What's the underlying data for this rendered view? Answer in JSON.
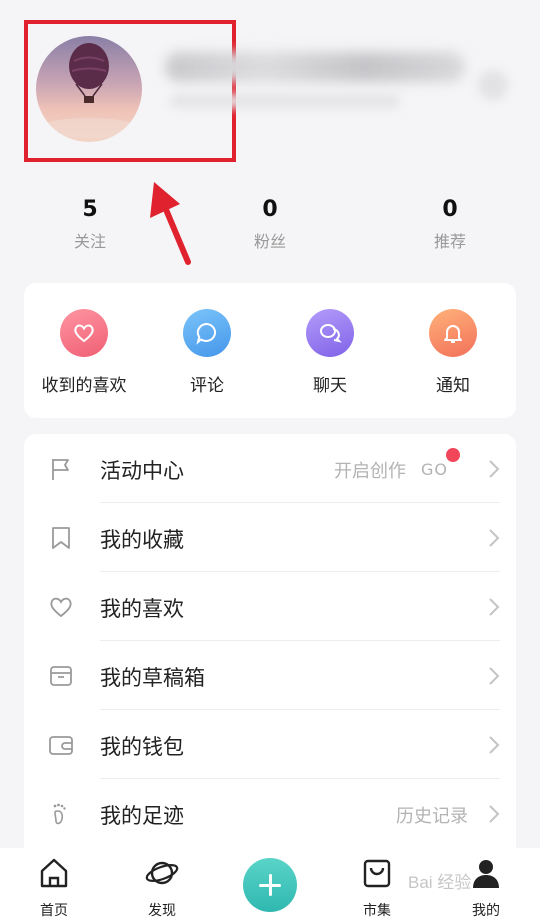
{
  "stats": [
    {
      "value": "5",
      "label": "关注"
    },
    {
      "value": "0",
      "label": "粉丝"
    },
    {
      "value": "0",
      "label": "推荐"
    }
  ],
  "actions": [
    {
      "label": "收到的喜欢",
      "icon": "heart-icon",
      "color": "#f26c7e"
    },
    {
      "label": "评论",
      "icon": "comment-icon",
      "color": "#56a8f0"
    },
    {
      "label": "聊天",
      "icon": "chat-icon",
      "color": "#9a7ef0"
    },
    {
      "label": "通知",
      "icon": "bell-icon",
      "color": "#f58a62"
    }
  ],
  "menu": [
    {
      "label": "活动中心",
      "icon": "flag-icon",
      "hint": "开启创作",
      "badge": "GO"
    },
    {
      "label": "我的收藏",
      "icon": "bookmark-icon",
      "hint": ""
    },
    {
      "label": "我的喜欢",
      "icon": "heart-outline-icon",
      "hint": ""
    },
    {
      "label": "我的草稿箱",
      "icon": "drafts-box-icon",
      "hint": ""
    },
    {
      "label": "我的钱包",
      "icon": "wallet-icon",
      "hint": ""
    },
    {
      "label": "我的足迹",
      "icon": "footprint-icon",
      "hint": "历史记录"
    }
  ],
  "nav": [
    {
      "label": "首页",
      "icon": "home-icon"
    },
    {
      "label": "发现",
      "icon": "planet-icon"
    },
    {
      "label": "",
      "icon": "plus-icon"
    },
    {
      "label": "市集",
      "icon": "shopping-bag-icon"
    },
    {
      "label": "我的",
      "icon": "profile-icon"
    }
  ],
  "watermark": "Bai 经验",
  "colors": {
    "accent": "#3cc4bb",
    "highlight_box": "#e0212e",
    "badge_dot": "#f2465a"
  }
}
